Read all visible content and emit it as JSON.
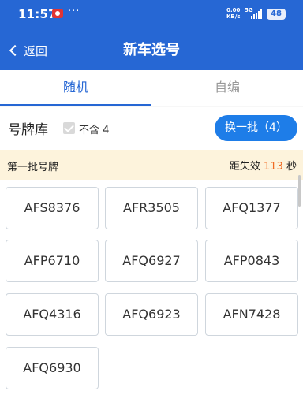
{
  "status_bar": {
    "time": "11:57",
    "more": "···",
    "net_speed_value": "0.00",
    "net_speed_unit": "KB/s",
    "network": "5G",
    "battery": "48"
  },
  "nav": {
    "back_label": "返回",
    "title": "新车选号"
  },
  "tabs": [
    {
      "label": "随机",
      "active": true
    },
    {
      "label": "自编",
      "active": false
    }
  ],
  "pool": {
    "title": "号牌库",
    "exclude_label": "不含 4",
    "exclude_checked": true,
    "refresh_button": "换一批（4）"
  },
  "batch": {
    "label": "第一批号牌",
    "countdown_prefix": "距失效",
    "countdown_seconds": "113",
    "countdown_unit": "秒"
  },
  "plates": [
    "AFS8376",
    "AFR3505",
    "AFQ1377",
    "AFP6710",
    "AFQ6927",
    "AFP0843",
    "AFQ4316",
    "AFQ6923",
    "AFN7428",
    "AFQ6930"
  ],
  "colors": {
    "primary": "#2667d4",
    "button": "#1e7de8",
    "countdown": "#f06a22",
    "banner": "#fdf3dc"
  }
}
